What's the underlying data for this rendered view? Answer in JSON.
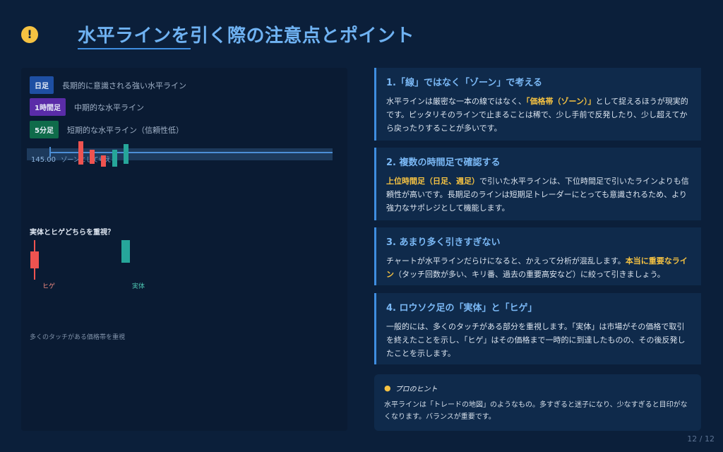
{
  "header": {
    "icon": "exclamation-icon",
    "icon_glyph": "!",
    "title": "水平ラインを引く際の注意点とポイント"
  },
  "left_panel": {
    "legend": [
      {
        "badge": "日足",
        "text": "長期的に意識される強い水平ライン",
        "color": "#1e4fa3"
      },
      {
        "badge": "1時間足",
        "text": "中期的な水平ライン",
        "color": "#5a2ca8"
      },
      {
        "badge": "5分足",
        "text": "短期的な水平ライン（信頼性低）",
        "color": "#0f6b4a"
      }
    ],
    "zone_label": "145.00",
    "zone_caption": "ゾーンとして考える",
    "sub_heading": "実体とヒゲどちらを重視？",
    "wick_caption": "ヒゲ",
    "body_caption": "実体",
    "bottom_note": "多くのタッチがある価格帯を重視"
  },
  "cards": [
    {
      "title": "1.「線」ではなく「ゾーン」で考える",
      "body_pre": "水平ラインは厳密な一本の線ではなく、",
      "body_hl": "「価格帯（ゾーン）」",
      "body_post": "として捉えるほうが現実的です。ピッタリそのラインで止まることは稀で、少し手前で反発したり、少し超えてから戻ったりすることが多いです。"
    },
    {
      "title": "2. 複数の時間足で確認する",
      "body_hl": "上位時間足（日足、週足）",
      "body_post": "で引いた水平ラインは、下位時間足で引いたラインよりも信頼性が高いです。長期足のラインは短期足トレーダーにとっても意識されるため、より強力なサポレジとして機能します。"
    },
    {
      "title": "3. あまり多く引きすぎない",
      "body_pre": "チャートが水平ラインだらけになると、かえって分析が混乱します。",
      "body_hl": "本当に重要なライン",
      "body_post": "（タッチ回数が多い、キリ番、過去の重要高安など）に絞って引きましょう。"
    },
    {
      "title": "4. ロウソク足の「実体」と「ヒゲ」",
      "body_post": "一般的には、多くのタッチがある部分を重視します。「実体」は市場がその価格で取引を終えたことを示し、「ヒゲ」はその価格まで一時的に到達したものの、その後反発したことを示します。"
    }
  ],
  "tip": {
    "icon": "lightbulb-icon",
    "heading": "プロのヒント",
    "body": "水平ラインは「トレードの地図」のようなもの。多すぎると迷子になり、少なすぎると目印がなくなります。バランスが重要です。"
  },
  "pager": "12 / 12"
}
